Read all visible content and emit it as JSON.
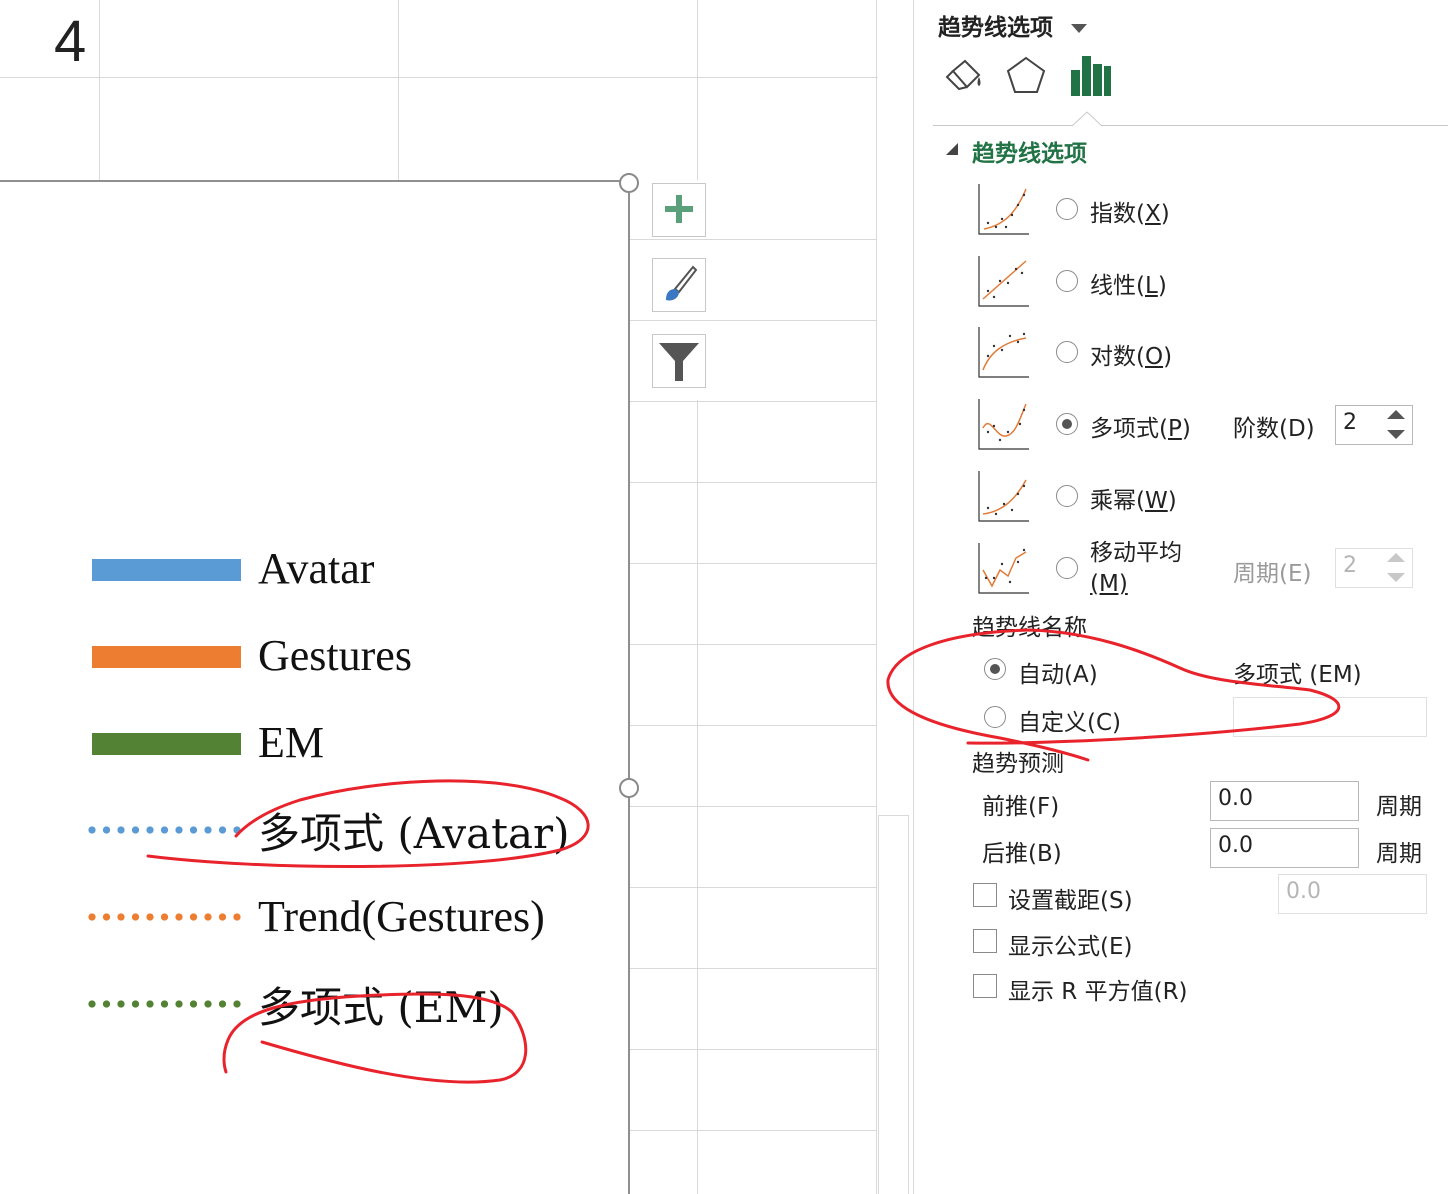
{
  "sheet": {
    "cell_value": "4"
  },
  "chart": {
    "legend": [
      {
        "label": "Avatar",
        "kind": "solid",
        "color": "#5b9bd5"
      },
      {
        "label": "Gestures",
        "kind": "solid",
        "color": "#ed7d31"
      },
      {
        "label": "EM",
        "kind": "solid",
        "color": "#548235"
      },
      {
        "label": "多项式 (Avatar)",
        "kind": "dotted",
        "color": "#5b9bd5"
      },
      {
        "label": "Trend(Gestures)",
        "kind": "dotted",
        "color": "#ed7d31"
      },
      {
        "label": "多项式 (EM)",
        "kind": "dotted",
        "color": "#548235"
      }
    ],
    "tools": [
      {
        "name": "chart-elements-button",
        "icon": "plus-icon"
      },
      {
        "name": "chart-styles-button",
        "icon": "brush-icon"
      },
      {
        "name": "chart-filters-button",
        "icon": "funnel-icon"
      }
    ]
  },
  "pane": {
    "header_title": "趋势线选项",
    "tab_icons": [
      "paint-bucket-icon",
      "pentagon-icon",
      "bar-chart-icon"
    ],
    "section_title": "趋势线选项",
    "types": [
      {
        "label_main": "指数(",
        "label_key": "X",
        "label_end": ")",
        "selected": false
      },
      {
        "label_main": "线性(",
        "label_key": "L",
        "label_end": ")",
        "selected": false
      },
      {
        "label_main": "对数(",
        "label_key": "O",
        "label_end": ")",
        "selected": false
      },
      {
        "label_main": "多项式(",
        "label_key": "P",
        "label_end": ")",
        "selected": true
      },
      {
        "label_main": "乘幂(",
        "label_key": "W",
        "label_end": ")",
        "selected": false
      },
      {
        "label_main": "移动平均",
        "label_key": "(M)",
        "label_end": "",
        "selected": false
      }
    ],
    "order_label": "阶数(D)",
    "order_value": "2",
    "period_label": "周期(E)",
    "period_value": "2",
    "name_section": "趋势线名称",
    "auto_label": "自动(A)",
    "auto_value": "多项式 (EM)",
    "custom_label": "自定义(C)",
    "custom_value": "",
    "forecast_section": "趋势预测",
    "forward_label": "前推(F)",
    "forward_value": "0.0",
    "backward_label": "后推(B)",
    "backward_value": "0.0",
    "period_unit": "周期",
    "intercept_label": "设置截距(S)",
    "intercept_value": "0.0",
    "show_equation_label": "显示公式(E)",
    "show_r2_label": "显示 R 平方值(R)"
  },
  "annotation_color": "#e8232b"
}
